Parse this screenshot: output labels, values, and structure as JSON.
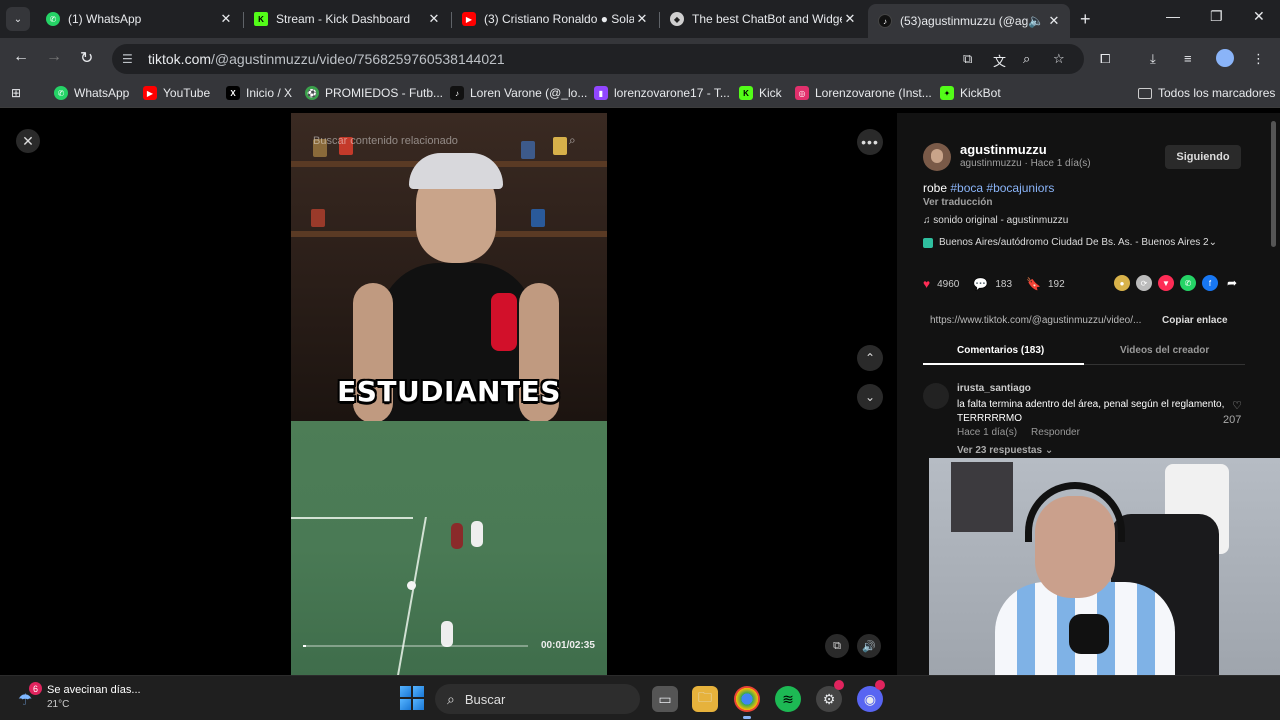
{
  "tabs": [
    {
      "title": "(1) WhatsApp",
      "icon": "whatsapp-icon",
      "color": "#25d366"
    },
    {
      "title": "Stream - Kick Dashboard",
      "icon": "kick-icon",
      "color": "#53fc18"
    },
    {
      "title": "(3) Cristiano Ronaldo ● Sola",
      "icon": "youtube-icon",
      "color": "#ff0000"
    },
    {
      "title": "The best ChatBot and Widge",
      "icon": "chatbot-icon",
      "color": "#cfcfcf"
    },
    {
      "title": "(53)agustinmuzzu (@ag",
      "icon": "tiktok-icon",
      "color": "#111111"
    }
  ],
  "address": {
    "domain": "tiktok.com",
    "path": "/@agustinmuzzu/video/7568259760538144021"
  },
  "bookmarks": [
    {
      "label": "WhatsApp",
      "icon": "whatsapp-icon",
      "color": "#25d366"
    },
    {
      "label": "YouTube",
      "icon": "youtube-icon",
      "color": "#ff0000"
    },
    {
      "label": "Inicio / X",
      "icon": "x-icon",
      "color": "#000000"
    },
    {
      "label": "PROMIEDOS - Futb...",
      "icon": "promiedos-icon",
      "color": "#3aa14b"
    },
    {
      "label": "Loren Varone (@_lo...",
      "icon": "tiktok-icon",
      "color": "#111111"
    },
    {
      "label": "lorenzovarone17 - T...",
      "icon": "twitch-icon",
      "color": "#9146ff"
    },
    {
      "label": "Kick",
      "icon": "kick-icon",
      "color": "#53fc18"
    },
    {
      "label": "Lorenzovarone (Inst...",
      "icon": "instagram-icon",
      "color": "#e1306c"
    },
    {
      "label": "KickBot",
      "icon": "kickbot-icon",
      "color": "#53fc18"
    }
  ],
  "bookmarks_all": "Todos los marcadores",
  "video": {
    "search_placeholder": "Buscar contenido relacionado",
    "caption": "ESTUDIANTES",
    "time": "00:01/02:35",
    "progress": 0.01
  },
  "post": {
    "username": "agustinmuzzu",
    "meta": "agustinmuzzu · Hace 1 día(s)",
    "follow": "Siguiendo",
    "desc_text": "robe ",
    "desc_tags": "#boca #bocajuniors",
    "translate": "Ver traducción",
    "sound": "♫  sonido original - agustinmuzzu",
    "location": "Buenos Aires/autódromo Ciudad De Bs. As. - Buenos Aires  2⌄",
    "likes": "4960",
    "comments": "183",
    "saves": "192",
    "link": "https://www.tiktok.com/@agustinmuzzu/video/...",
    "copy": "Copiar enlace",
    "tab_comments": "Comentarios (183)",
    "tab_videos": "Videos del creador"
  },
  "comment": {
    "user": "irusta_santiago",
    "text": "la falta termina adentro del área, penal según el reglamento, TERRRRRMO",
    "time": "Hace 1 día(s)",
    "reply": "Responder",
    "likes": "207",
    "replies": "Ver 23 respuestas ⌄"
  },
  "taskbar": {
    "weather_text": "Se avecinan días...",
    "weather_temp": "21°C",
    "weather_badge": "6",
    "search": "Buscar"
  }
}
